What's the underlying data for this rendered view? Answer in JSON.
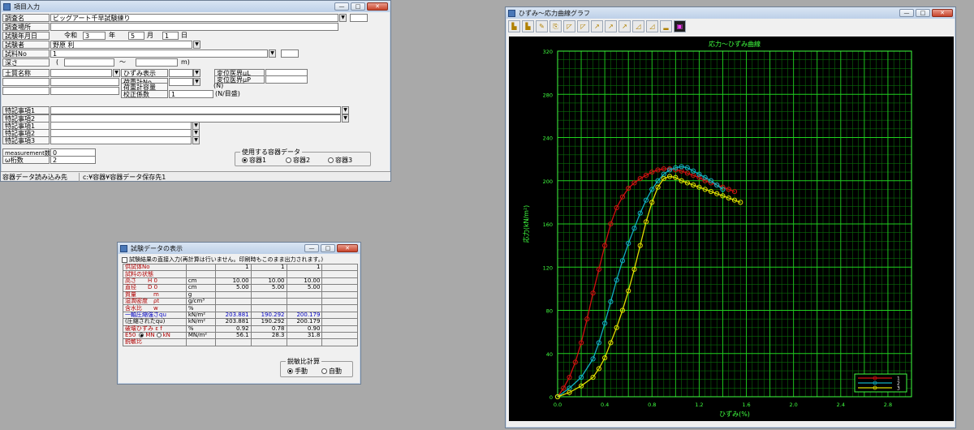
{
  "win1": {
    "title": "項目入力",
    "labels": {
      "survey_name": "調査名",
      "survey_place": "調査場所",
      "test_date": "試験年月日",
      "tester": "試験者",
      "sample_no": "試料No",
      "depth": "深さ",
      "soil_name": "土質名称",
      "strain_gauge": "ひずみ表示",
      "load_cell_no": "荷重計No",
      "load_meter_capacity": "荷重計容量",
      "correction_factor": "校正係数",
      "max_ring_disp": "変位医界μL",
      "max_ring_load": "変位医界μP",
      "note1": "特記事項1",
      "note2": "特記事項2",
      "remark1": "特記事項1",
      "remark2": "特記事項2",
      "remark3": "特記事項3",
      "measurement_count": "measurement数",
      "omega_count": "ω桁数"
    },
    "values": {
      "survey_name": "ビッグアート千早試験練り",
      "era": "令和",
      "year": "3",
      "year_unit": "年",
      "month": "5",
      "month_unit": "月",
      "day": "1",
      "day_unit": "日",
      "tester": "野原 利",
      "sample_no": "1",
      "depth_from": "(",
      "depth_tilde": "〜",
      "depth_to": "m)",
      "load_meter_unit": "(N)",
      "correction_factor": "1",
      "correction_unit": "(N/目盛)",
      "measurement_count": "0",
      "omega_count": "2"
    },
    "container_group": {
      "title": "使用する容器データ",
      "options": [
        "容器1",
        "容器2",
        "容器3"
      ],
      "selected": 0
    },
    "status": {
      "left": "容器データ読み込み先",
      "right": "c:¥容器¥容器データ保存先1"
    }
  },
  "win2": {
    "title": "試験データの表示",
    "checkbox_label": "試験結果の直接入力(再計算は行いません。印刷時もこのまま出力されます。)",
    "rows": [
      {
        "label": "供試体No",
        "unit": "",
        "cls": "red",
        "vals": [
          "1",
          "1",
          "1"
        ]
      },
      {
        "label": "試料の状態",
        "unit": "",
        "cls": "red",
        "vals": [
          "",
          "",
          ""
        ]
      },
      {
        "label": "高さ　　H 0",
        "unit": "cm",
        "cls": "red",
        "vals": [
          "10.00",
          "10.00",
          "10.00"
        ]
      },
      {
        "label": "直径　　D 0",
        "unit": "cm",
        "cls": "red",
        "vals": [
          "5.00",
          "5.00",
          "5.00"
        ]
      },
      {
        "label": "質量　　　m",
        "unit": "g",
        "cls": "red",
        "vals": [
          "",
          "",
          ""
        ]
      },
      {
        "label": "湿潤密度　ρt",
        "unit": "g/cm³",
        "cls": "red",
        "vals": [
          "",
          "",
          ""
        ]
      },
      {
        "label": "含水比　　w",
        "unit": "%",
        "cls": "red",
        "vals": [
          "",
          "",
          ""
        ]
      },
      {
        "label": "一軸圧縮強さqu",
        "unit": "kN/m²",
        "cls": "blue",
        "vals": [
          "203.881",
          "190.292",
          "200.179"
        ]
      },
      {
        "label": "(圧縮されたqu)",
        "unit": "kN/m²",
        "cls": "",
        "vals": [
          "203.881",
          "190.292",
          "200.179"
        ]
      },
      {
        "label": "破壊ひずみ ε f",
        "unit": "%",
        "cls": "red",
        "vals": [
          "0.92",
          "0.78",
          "0.90"
        ]
      },
      {
        "label": "E50",
        "unit": "MN/m²",
        "cls": "red",
        "vals": [
          "56.1",
          "28.3",
          "31.8"
        ]
      },
      {
        "label": "鋭敏比",
        "unit": "",
        "cls": "red",
        "vals": [
          "",
          "",
          ""
        ]
      }
    ],
    "e50_units": [
      "MN",
      "kN"
    ],
    "group": {
      "title": "鋭敏比計算",
      "options": [
        "手動",
        "自動"
      ],
      "selected": 0
    }
  },
  "win3": {
    "title": "ひずみ〜応力曲線グラフ",
    "tool_icons": [
      "open-icon",
      "save-icon",
      "print-icon",
      "copy-icon",
      "graph1-icon",
      "graph2-icon",
      "graph3-icon",
      "graph4-icon",
      "graph5-icon",
      "graph6-icon",
      "graph7-icon",
      "graph8-icon",
      "color-icon"
    ]
  },
  "chart_data": {
    "type": "line",
    "title": "応力〜ひずみ曲線",
    "xlabel": "ひずみ(%)",
    "ylabel": "応力(kN/m²)",
    "xlim": [
      0,
      3.0
    ],
    "ylim": [
      0,
      320
    ],
    "xticks": [
      "0.0",
      "0.4",
      "0.8",
      "1.2",
      "1.6",
      "2.0",
      "2.4",
      "2.8"
    ],
    "yticks": [
      "0",
      "40",
      "80",
      "120",
      "160",
      "200",
      "240",
      "280",
      "320"
    ],
    "grid": true,
    "legend_position": "bottom-right",
    "legend_labels": [
      "1",
      "2",
      "3"
    ],
    "series": [
      {
        "name": "1",
        "color": "#d01010",
        "x": [
          0.0,
          0.05,
          0.1,
          0.15,
          0.2,
          0.25,
          0.3,
          0.35,
          0.4,
          0.45,
          0.5,
          0.55,
          0.6,
          0.65,
          0.7,
          0.75,
          0.8,
          0.85,
          0.9,
          0.95,
          1.0,
          1.05,
          1.1,
          1.15,
          1.2,
          1.25,
          1.3,
          1.35,
          1.4,
          1.45,
          1.5
        ],
        "y": [
          0,
          8,
          18,
          32,
          50,
          72,
          96,
          118,
          140,
          160,
          175,
          185,
          193,
          198,
          202,
          205,
          208,
          210,
          211,
          211,
          210,
          209,
          207,
          205,
          203,
          200,
          198,
          196,
          194,
          192,
          190
        ]
      },
      {
        "name": "2",
        "color": "#10b0c0",
        "x": [
          0.0,
          0.1,
          0.2,
          0.3,
          0.35,
          0.4,
          0.45,
          0.5,
          0.55,
          0.6,
          0.65,
          0.7,
          0.75,
          0.8,
          0.85,
          0.9,
          0.95,
          1.0,
          1.05,
          1.1,
          1.15,
          1.2,
          1.25,
          1.3,
          1.35,
          1.4
        ],
        "y": [
          0,
          8,
          18,
          35,
          50,
          68,
          88,
          108,
          126,
          142,
          156,
          170,
          182,
          192,
          200,
          206,
          210,
          212,
          213,
          212,
          209,
          206,
          203,
          200,
          196,
          192
        ]
      },
      {
        "name": "3",
        "color": "#e0e000",
        "x": [
          0.0,
          0.1,
          0.2,
          0.3,
          0.35,
          0.4,
          0.45,
          0.5,
          0.55,
          0.6,
          0.65,
          0.7,
          0.75,
          0.8,
          0.85,
          0.9,
          0.95,
          1.0,
          1.05,
          1.1,
          1.15,
          1.2,
          1.25,
          1.3,
          1.35,
          1.4,
          1.45,
          1.5,
          1.55
        ],
        "y": [
          0,
          4,
          10,
          18,
          26,
          36,
          50,
          64,
          80,
          98,
          118,
          140,
          162,
          180,
          194,
          202,
          204,
          203,
          200,
          198,
          196,
          194,
          192,
          190,
          188,
          186,
          184,
          182,
          180
        ]
      }
    ]
  }
}
